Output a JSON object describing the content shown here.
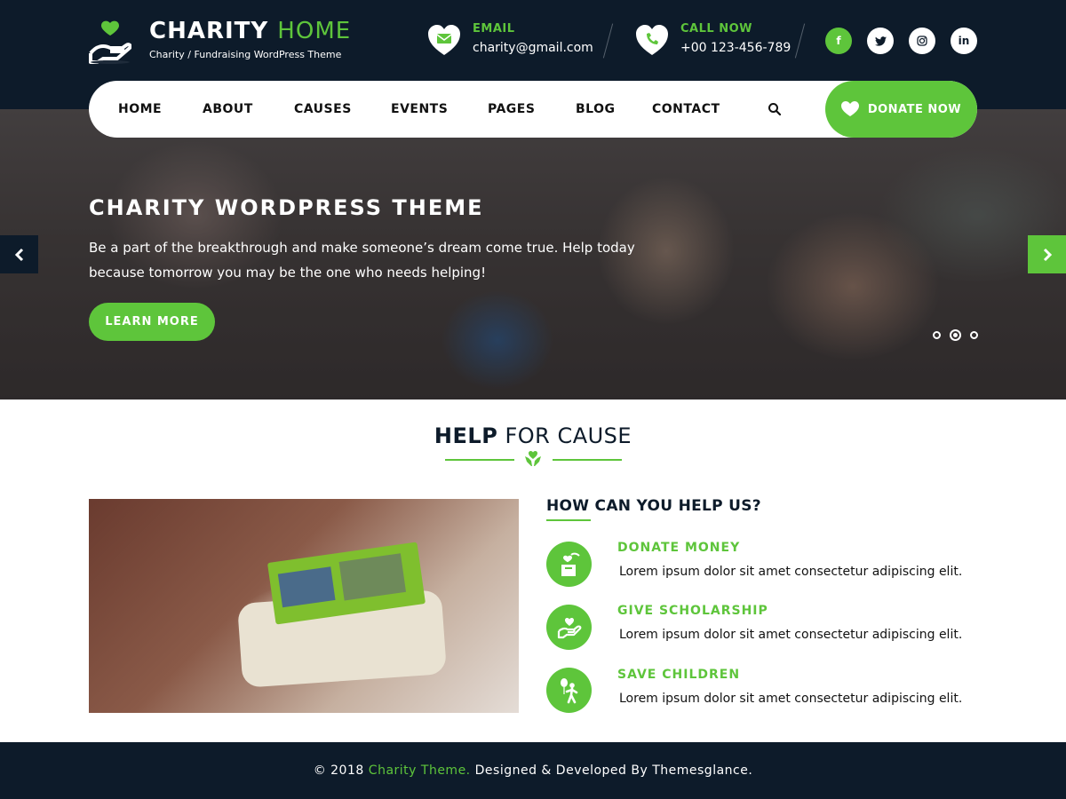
{
  "header": {
    "brand_main": "CHARITY",
    "brand_accent": "HOME",
    "tagline": "Charity / Fundraising WordPress Theme",
    "email_label": "EMAIL",
    "email_value": "charity@gmail.com",
    "phone_label": "CALL NOW",
    "phone_value": "+00 123-456-789",
    "socials": [
      "facebook-icon",
      "twitter-icon",
      "instagram-icon",
      "linkedin-icon"
    ]
  },
  "nav": {
    "items": [
      "HOME",
      "ABOUT",
      "CAUSES",
      "EVENTS",
      "PAGES",
      "BLOG",
      "CONTACT"
    ],
    "donate_label": "DONATE NOW"
  },
  "hero": {
    "title": "CHARITY WORDPRESS THEME",
    "text": "Be a part of the breakthrough and make someone’s dream come true. Help today because tomorrow you may be the one who needs helping!",
    "button_label": "LEARN MORE",
    "slides_count": 3,
    "active_slide": 2
  },
  "help_section": {
    "title_strong": "HELP",
    "title_rest": "FOR CAUSE",
    "heading": "HOW CAN YOU HELP US?",
    "items": [
      {
        "title": "DONATE MONEY",
        "text": "Lorem ipsum dolor sit amet consectetur adipiscing elit.",
        "icon": "donation-box-icon"
      },
      {
        "title": "GIVE SCHOLARSHIP",
        "text": "Lorem ipsum dolor sit amet consectetur adipiscing elit.",
        "icon": "hand-heart-icon"
      },
      {
        "title": "SAVE CHILDREN",
        "text": "Lorem ipsum dolor sit amet consectetur adipiscing elit.",
        "icon": "child-balloon-icon"
      }
    ]
  },
  "footer": {
    "prefix": "© 2018",
    "link": "Charity Theme.",
    "suffix": "Designed & Developed By Themesglance."
  },
  "colors": {
    "dark": "#0d1b2a",
    "accent": "#5ec53b",
    "white": "#ffffff"
  }
}
